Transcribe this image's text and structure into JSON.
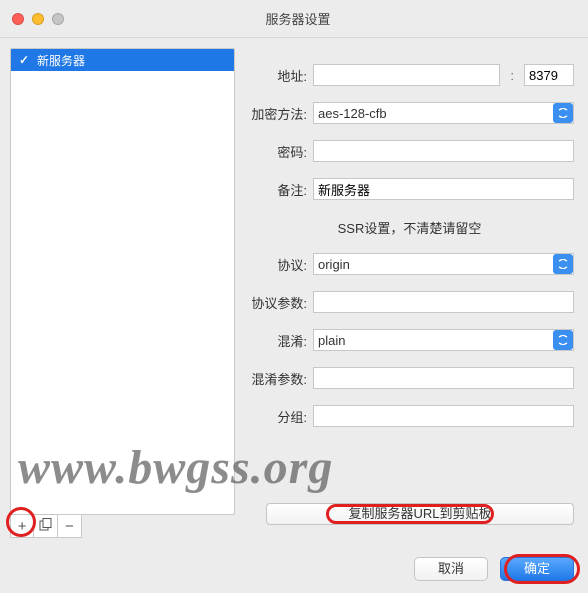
{
  "window": {
    "title": "服务器设置"
  },
  "sidebar": {
    "items": [
      {
        "label": "新服务器",
        "selected": true
      }
    ],
    "toolbar": {
      "add": "+",
      "duplicate": "⿻",
      "remove": "−"
    }
  },
  "form": {
    "address_label": "地址",
    "address_value": "",
    "port_value": "8379",
    "encryption_label": "加密方法",
    "encryption_value": "aes-128-cfb",
    "password_label": "密码",
    "password_value": "",
    "remark_label": "备注",
    "remark_value": "新服务器",
    "ssr_note": "SSR设置，不清楚请留空",
    "protocol_label": "协议",
    "protocol_value": "origin",
    "protocol_param_label": "协议参数",
    "protocol_param_value": "",
    "obfs_label": "混淆",
    "obfs_value": "plain",
    "obfs_param_label": "混淆参数",
    "obfs_param_value": "",
    "group_label": "分组",
    "group_value": "",
    "copy_btn": "复制服务器URL到剪贴板"
  },
  "footer": {
    "cancel": "取消",
    "ok": "确定"
  },
  "watermark": "www.bwgss.org"
}
